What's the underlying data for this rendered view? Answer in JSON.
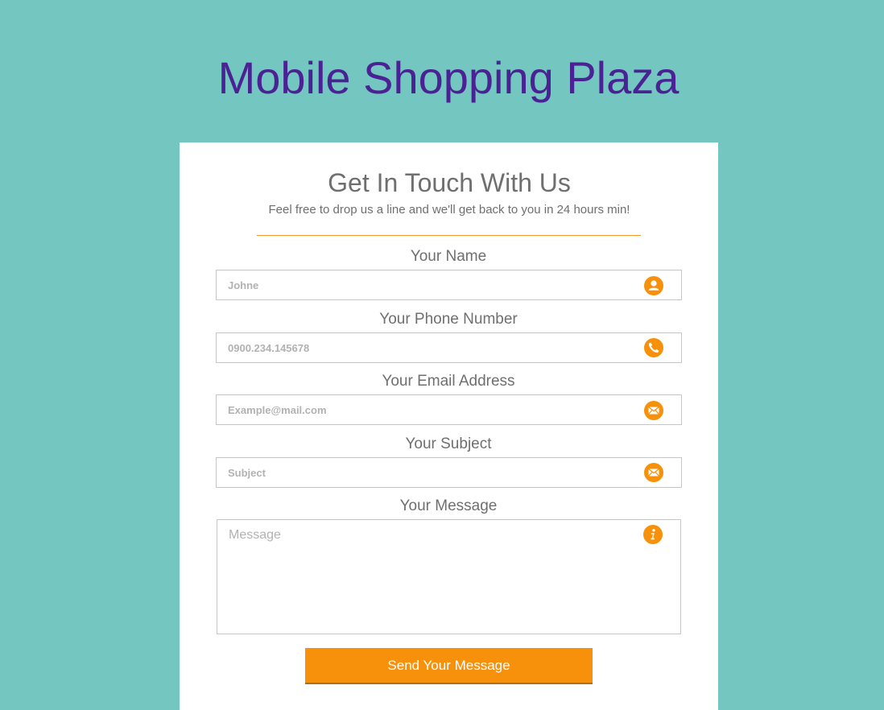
{
  "site": {
    "title": "Mobile Shopping Plaza"
  },
  "form": {
    "title": "Get In Touch With Us",
    "subtitle": "Feel free to drop us a line and we'll get back to you in 24 hours min!",
    "fields": {
      "name": {
        "label": "Your Name",
        "placeholder": "Johne",
        "icon": "user-icon"
      },
      "phone": {
        "label": "Your Phone Number",
        "placeholder": "0900.234.145678",
        "icon": "phone-icon"
      },
      "email": {
        "label": "Your Email Address",
        "placeholder": "Example@mail.com",
        "icon": "envelope-icon"
      },
      "subject": {
        "label": "Your Subject",
        "placeholder": "Subject",
        "icon": "envelope-icon"
      },
      "message": {
        "label": "Your Message",
        "placeholder": "Message",
        "icon": "info-icon"
      }
    },
    "submit_label": "Send Your Message"
  },
  "colors": {
    "background": "#74c6c1",
    "title": "#4a2293",
    "accent": "#f7900a",
    "text": "#6f6f6f"
  }
}
